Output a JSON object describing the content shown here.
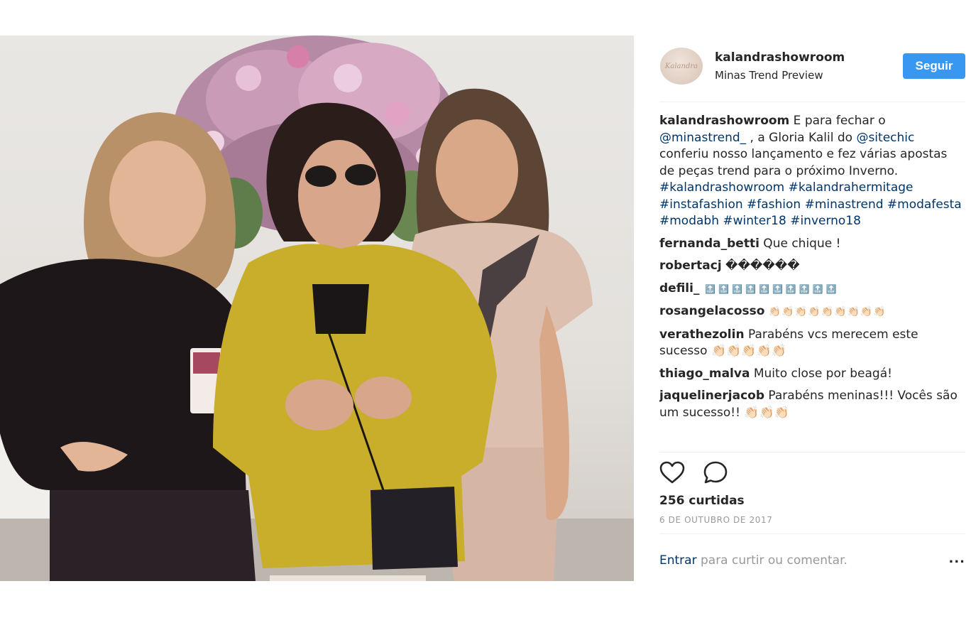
{
  "post": {
    "photo_alt": ""
  },
  "header": {
    "username": "kalandrashowroom",
    "location": "Minas Trend Preview",
    "follow_label": "Seguir",
    "avatar_text": "Kalandra"
  },
  "caption": {
    "username": "kalandrashowroom",
    "text_1": " E para fechar o ",
    "mention_1": "@minastrend_",
    "text_2": " , a Gloria Kalil do ",
    "mention_2": "@sitechic",
    "text_3": " conferiu nosso lançamento e fez várias apostas de peças trend para o próximo Inverno.",
    "hashtags": [
      "#kalandrashowroom",
      "#kalandrahermitage",
      "#instafashion",
      "#fashion",
      "#minastrend",
      "#modafesta",
      "#modabh",
      "#winter18",
      "#inverno18"
    ]
  },
  "comments": [
    {
      "user": "fernanda_betti",
      "text": " Que chique !"
    },
    {
      "user": "robertacj",
      "text": " ������"
    },
    {
      "user": "defili_",
      "text": " 🔝🔝🔝🔝🔝🔝🔝🔝🔝🔝"
    },
    {
      "user": "rosangelacosso",
      "text": " 👏🏻👏🏻👏🏻👏🏻👏🏻👏🏻👏🏻👏🏻👏🏻"
    },
    {
      "user": "verathezolin",
      "text": " Parabéns vcs merecem este sucesso 👏🏻👏🏻👏🏻👏🏻👏🏻"
    },
    {
      "user": "thiago_malva",
      "text": " Muito close por beagá!"
    },
    {
      "user": "jaquelinerjacob",
      "text": " Parabéns meninas!!! Vocês são um sucesso!! 👏🏻👏🏻👏🏻"
    }
  ],
  "likes": "256 curtidas",
  "date": "6 DE OUTUBRO DE 2017",
  "login": {
    "enter": "Entrar",
    "rest": " para curtir ou comentar.",
    "more": "..."
  },
  "colors": {
    "follow_bg": "#3897f0",
    "link": "#003569",
    "muted": "#999999",
    "jacket": "#c9ae2c"
  },
  "icons": [
    "heart-icon",
    "comment-icon",
    "more-icon"
  ]
}
